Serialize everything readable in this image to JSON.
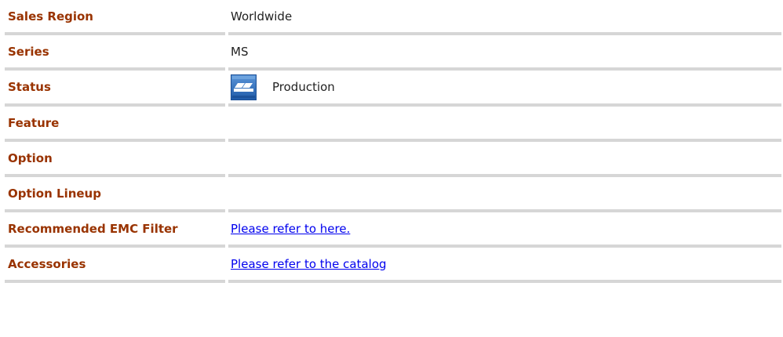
{
  "rows": [
    {
      "label": "Sales Region",
      "value": "Worldwide"
    },
    {
      "label": "Series",
      "value": "MS"
    },
    {
      "label": "Status",
      "value": "Production",
      "icon": "production-status-icon"
    },
    {
      "label": "Feature",
      "value": ""
    },
    {
      "label": "Option",
      "value": ""
    },
    {
      "label": "Option Lineup",
      "value": ""
    },
    {
      "label": "Recommended EMC Filter",
      "link": "Please refer to here."
    },
    {
      "label": "Accessories",
      "link": "Please refer to the catalog"
    }
  ],
  "colors": {
    "label": "#993300",
    "link": "#0000ee",
    "divider": "#d6d6d6",
    "icon_blue": "#2e6fc0"
  }
}
